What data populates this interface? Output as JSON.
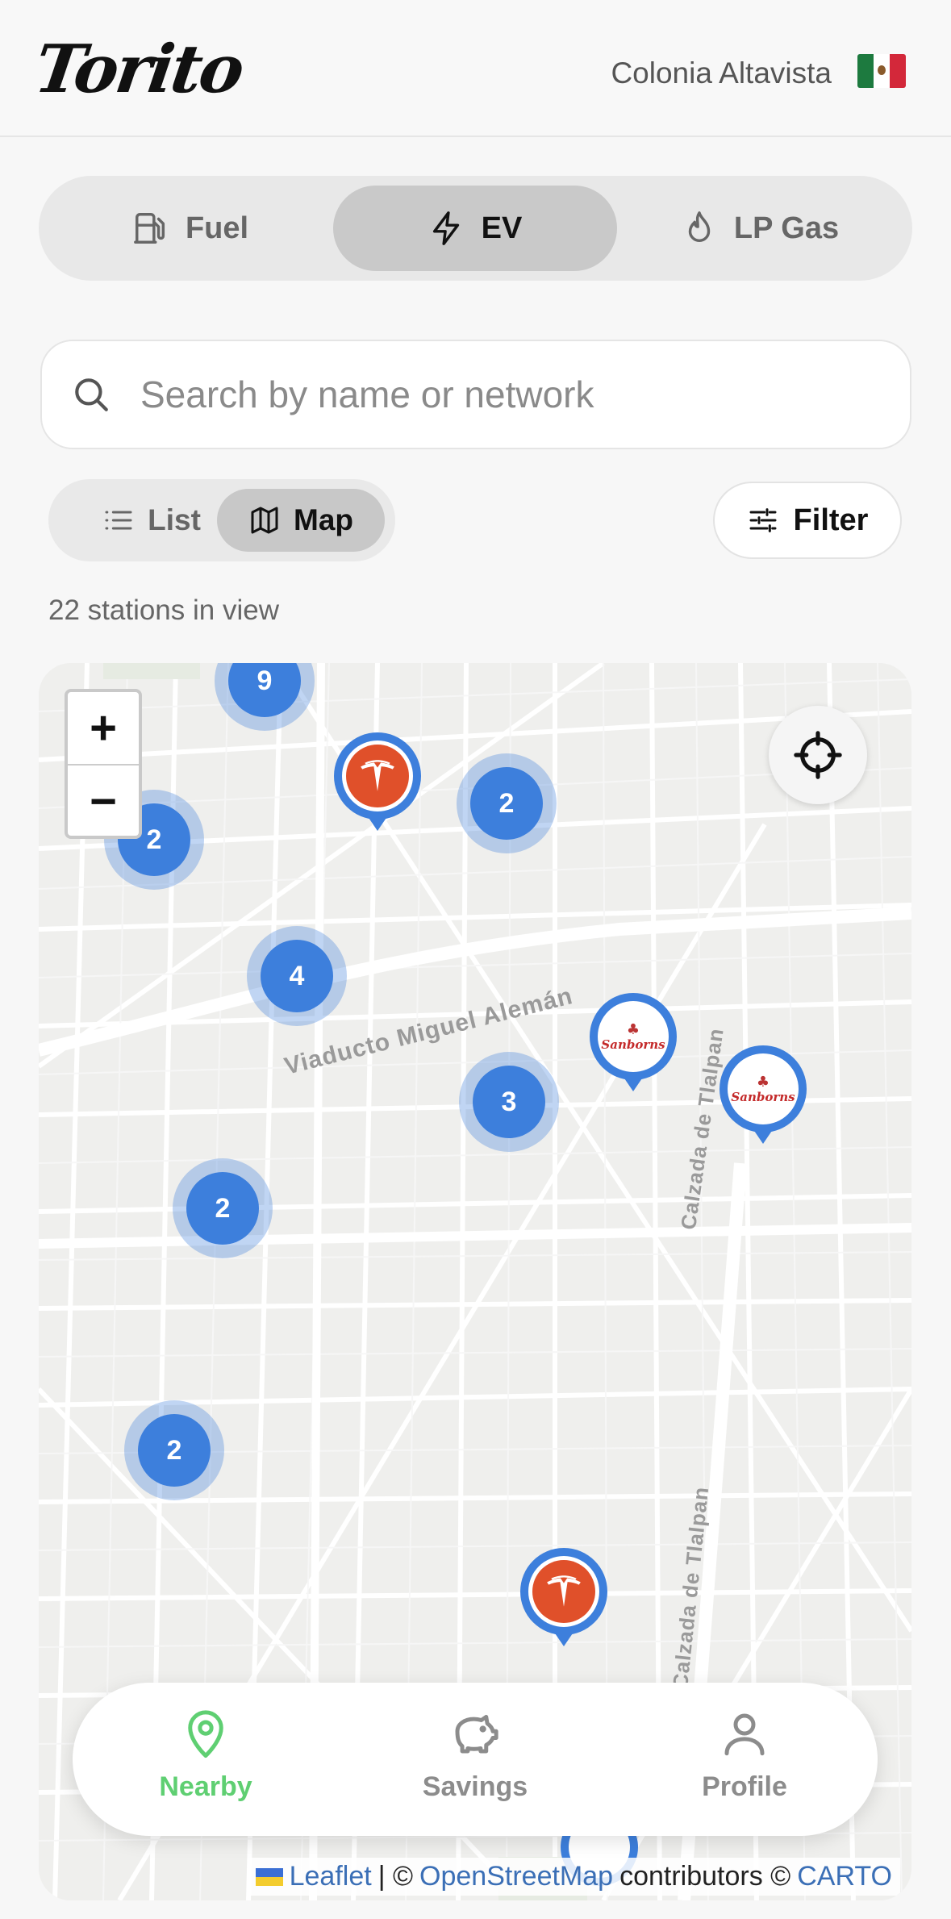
{
  "header": {
    "logo": "Torito",
    "location": "Colonia Altavista",
    "flag_icon": "mexico-flag-icon"
  },
  "fuel_tabs": [
    {
      "label": "Fuel",
      "icon": "fuel-pump-icon",
      "active": false
    },
    {
      "label": "EV",
      "icon": "lightning-bolt-icon",
      "active": true
    },
    {
      "label": "LP Gas",
      "icon": "flame-icon",
      "active": false
    }
  ],
  "search": {
    "placeholder": "Search by name or network",
    "value": ""
  },
  "view_toggle": [
    {
      "label": "List",
      "icon": "list-icon",
      "active": false
    },
    {
      "label": "Map",
      "icon": "map-icon",
      "active": true
    }
  ],
  "filter": {
    "label": "Filter",
    "icon": "sliders-icon"
  },
  "stations_count": "22 stations in view",
  "map": {
    "zoom_in": "+",
    "zoom_out": "−",
    "clusters": [
      "9",
      "2",
      "2",
      "4",
      "3",
      "2",
      "2"
    ],
    "road_labels": [
      "Viaducto Miguel Alemán",
      "Calzada de Tlalpan",
      "Calzada de Tlalpan"
    ],
    "pins": [
      {
        "brand": "tesla"
      },
      {
        "brand": "Sanborns"
      },
      {
        "brand": "Sanborns"
      },
      {
        "brand": "tesla"
      }
    ],
    "attribution": {
      "leaflet": "Leaflet",
      "sep": "| ©",
      "osm": "OpenStreetMap",
      "contrib": "contributors ©",
      "carto": "CARTO"
    }
  },
  "bottom_nav": [
    {
      "label": "Nearby",
      "icon": "map-pin-icon",
      "active": true
    },
    {
      "label": "Savings",
      "icon": "piggy-bank-icon",
      "active": false
    },
    {
      "label": "Profile",
      "icon": "user-icon",
      "active": false
    }
  ],
  "colors": {
    "accent_green": "#5fcf72",
    "cluster_blue": "#3d7fdc",
    "tesla_red": "#e0502a"
  }
}
